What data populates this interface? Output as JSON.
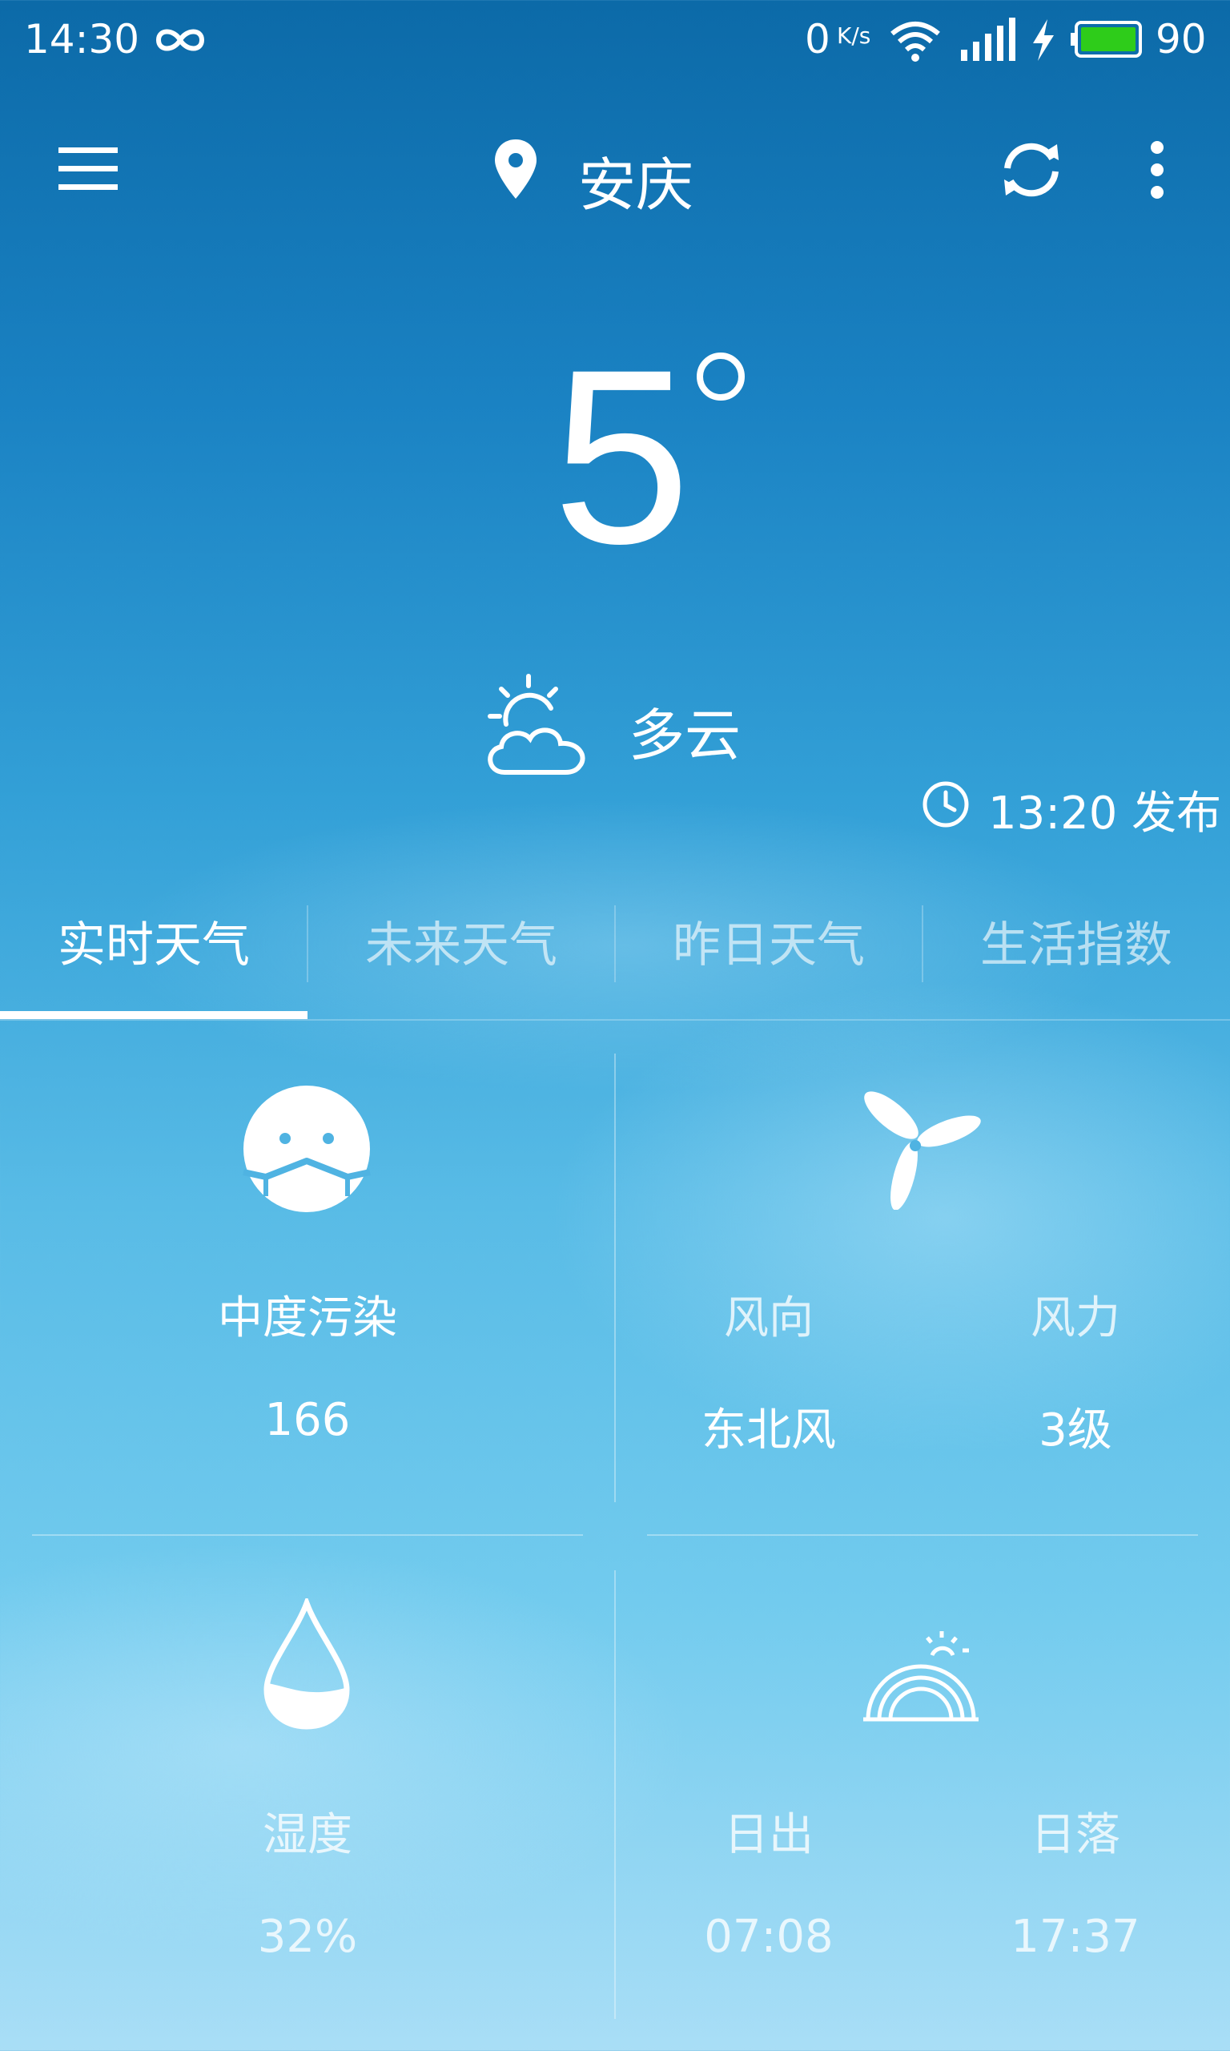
{
  "status_bar": {
    "time": "14:30",
    "net_speed": "0",
    "net_speed_unit": "K/s",
    "battery_percent": "90",
    "battery_color": "#2ecc1a"
  },
  "toolbar": {
    "city": "安庆",
    "icons": [
      "menu-icon",
      "location-pin-icon",
      "refresh-icon",
      "more-vert-icon"
    ]
  },
  "current": {
    "temperature": "5",
    "condition": "多云",
    "condition_icon": "partly-cloudy-icon",
    "publish_time": "13:20 发布"
  },
  "tabs": [
    {
      "label": "实时天气",
      "active": true
    },
    {
      "label": "未来天气",
      "active": false
    },
    {
      "label": "昨日天气",
      "active": false
    },
    {
      "label": "生活指数",
      "active": false
    }
  ],
  "details": {
    "air": {
      "label": "中度污染",
      "value": "166",
      "icon": "mask-face-icon"
    },
    "wind": {
      "icon": "wind-turbine-icon",
      "direction_label": "风向",
      "direction_value": "东北风",
      "force_label": "风力",
      "force_value": "3级"
    },
    "humidity": {
      "label": "湿度",
      "value": "32%",
      "icon": "water-drop-icon"
    },
    "sun": {
      "icon": "sunrise-icon",
      "sunrise_label": "日出",
      "sunrise_value": "07:08",
      "sunset_label": "日落",
      "sunset_value": "17:37"
    }
  }
}
